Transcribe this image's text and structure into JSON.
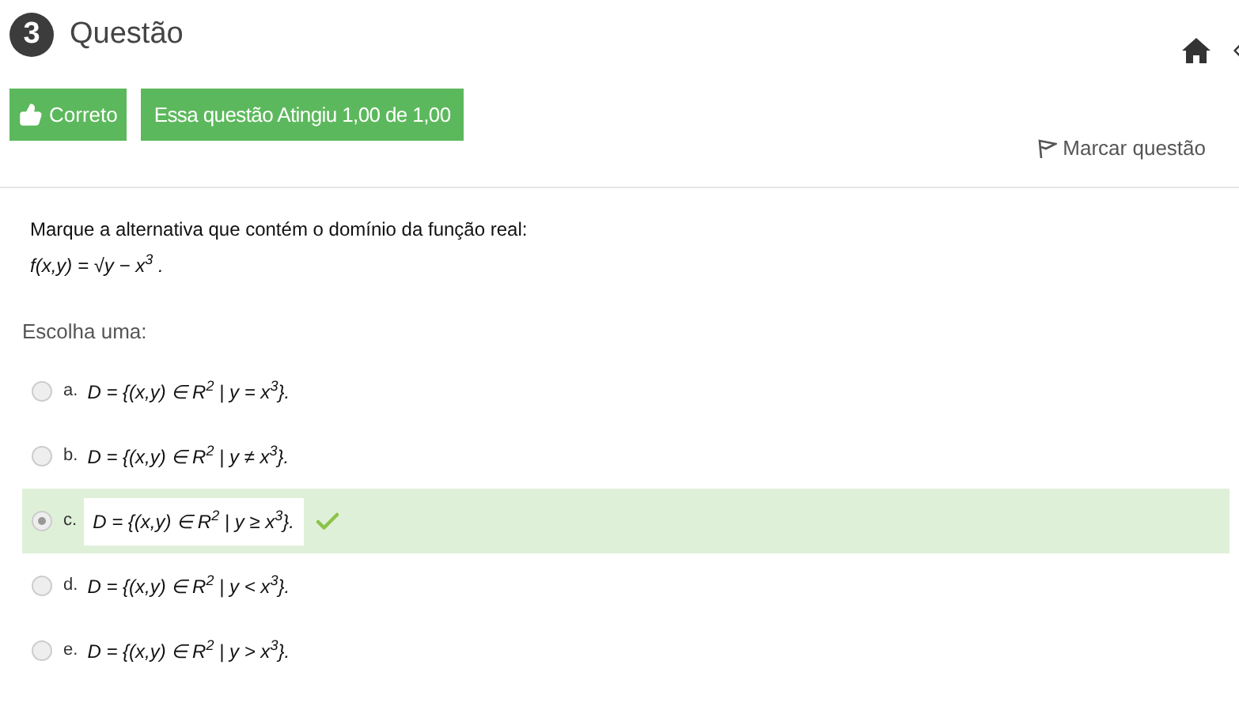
{
  "question": {
    "number": "3",
    "title": "Questão"
  },
  "status": {
    "result": "Correto",
    "grade": "Essa questão Atingiu 1,00 de 1,00"
  },
  "flag": {
    "label": "Marcar questão"
  },
  "prompt": {
    "text": "Marque  a alternativa  que contém o domínio da função real:",
    "formula": "f(x,y) = √y − x$^{3}$  ."
  },
  "choose_label": "Escolha uma:",
  "options": [
    {
      "letter": "a.",
      "formula": "D = {(x,y) ∈ R$^{2}$ | y = x$^{3}$}.",
      "selected": false,
      "correct": false
    },
    {
      "letter": "b.",
      "formula": "D = {(x,y) ∈ R$^{2}$ | y ≠ x$^{3}$}.",
      "selected": false,
      "correct": false
    },
    {
      "letter": "c.",
      "formula": "D = {(x,y) ∈ R$^{2}$ | y ≥ x$^{3}$}.",
      "selected": true,
      "correct": true
    },
    {
      "letter": "d.",
      "formula": "D = {(x,y) ∈ R$^{2}$ | y < x$^{3}$}.",
      "selected": false,
      "correct": false
    },
    {
      "letter": "e.",
      "formula": "D = {(x,y) ∈ R$^{2}$ | y > x$^{3}$}.",
      "selected": false,
      "correct": false
    }
  ]
}
